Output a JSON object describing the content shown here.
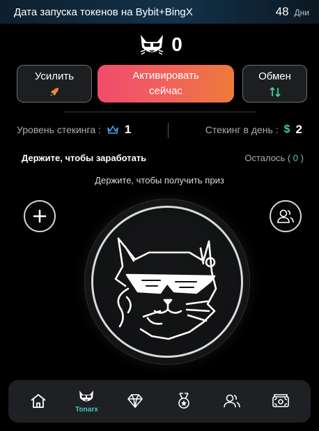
{
  "header": {
    "title": "Дата запуска токенов на Bybit+BingX",
    "days_value": "48",
    "days_unit": "Дни"
  },
  "balance": {
    "value": "0",
    "icon": "cat-sunglasses-icon"
  },
  "buttons": {
    "boost": {
      "label": "Усилить",
      "icon": "rocket-icon"
    },
    "activate": {
      "label_line1": "Активировать",
      "label_line2": "сейчас"
    },
    "swap": {
      "label": "Обмен",
      "icon": "swap-arrows-icon"
    }
  },
  "stats": {
    "staking_level_label": "Уровень стекинга :",
    "staking_level_value": "1",
    "staking_per_day_label": "Стекинг в день :",
    "staking_per_day_currency": "$",
    "staking_per_day_value": "2"
  },
  "hold": {
    "title": "Держите, чтобы заработать",
    "remaining_label": "Осталось (",
    "remaining_value": "0",
    "remaining_close": ")"
  },
  "hint": "Держите, чтобы получить приз",
  "nav": {
    "items": [
      {
        "icon": "home-icon",
        "label": ""
      },
      {
        "icon": "cat-avatar-icon",
        "label": "Tonarx"
      },
      {
        "icon": "diamond-icon",
        "label": ""
      },
      {
        "icon": "medal-icon",
        "label": ""
      },
      {
        "icon": "friends-icon",
        "label": ""
      },
      {
        "icon": "wallet-icon",
        "label": ""
      }
    ]
  },
  "colors": {
    "accent_teal": "#45c9b9",
    "dollar_green": "#3fd39a",
    "activate_start": "#f14b6d",
    "activate_end": "#ee7a3a",
    "crown_blue": "#4a9fe8"
  }
}
